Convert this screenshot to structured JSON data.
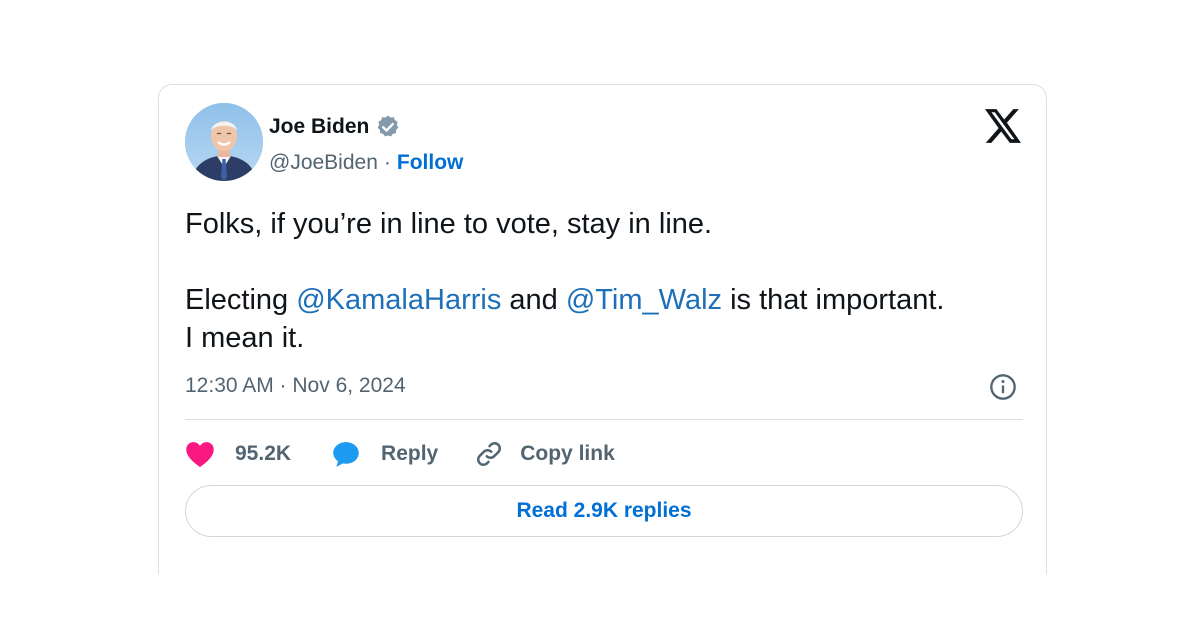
{
  "author": {
    "name": "Joe Biden",
    "handle": "@JoeBiden",
    "separator": "·",
    "follow_label": "Follow",
    "verified_icon": "verified-badge-icon",
    "verified_color": "#829aab"
  },
  "brand": {
    "logo_icon": "x-logo-icon"
  },
  "tweet": {
    "line1": "Folks, if you’re in line to vote, stay in line.",
    "line2_prefix": "Electing ",
    "mention1": "@KamalaHarris",
    "line2_middle": " and ",
    "mention2": "@Tim_Walz",
    "line2_suffix": " is that important.",
    "line3": "I mean it.",
    "mention_color": "#1d6fb8"
  },
  "meta": {
    "timestamp": "12:30 AM · Nov 6, 2024",
    "info_icon": "info-icon"
  },
  "actions": {
    "like_count": "95.2K",
    "like_icon": "heart-icon",
    "like_color": "#f91880",
    "reply_label": "Reply",
    "reply_icon": "speech-bubble-icon",
    "reply_color": "#1d9bf0",
    "copy_label": "Copy link",
    "copy_icon": "link-icon"
  },
  "read_replies": {
    "label": "Read 2.9K replies",
    "color": "#006fd6"
  }
}
